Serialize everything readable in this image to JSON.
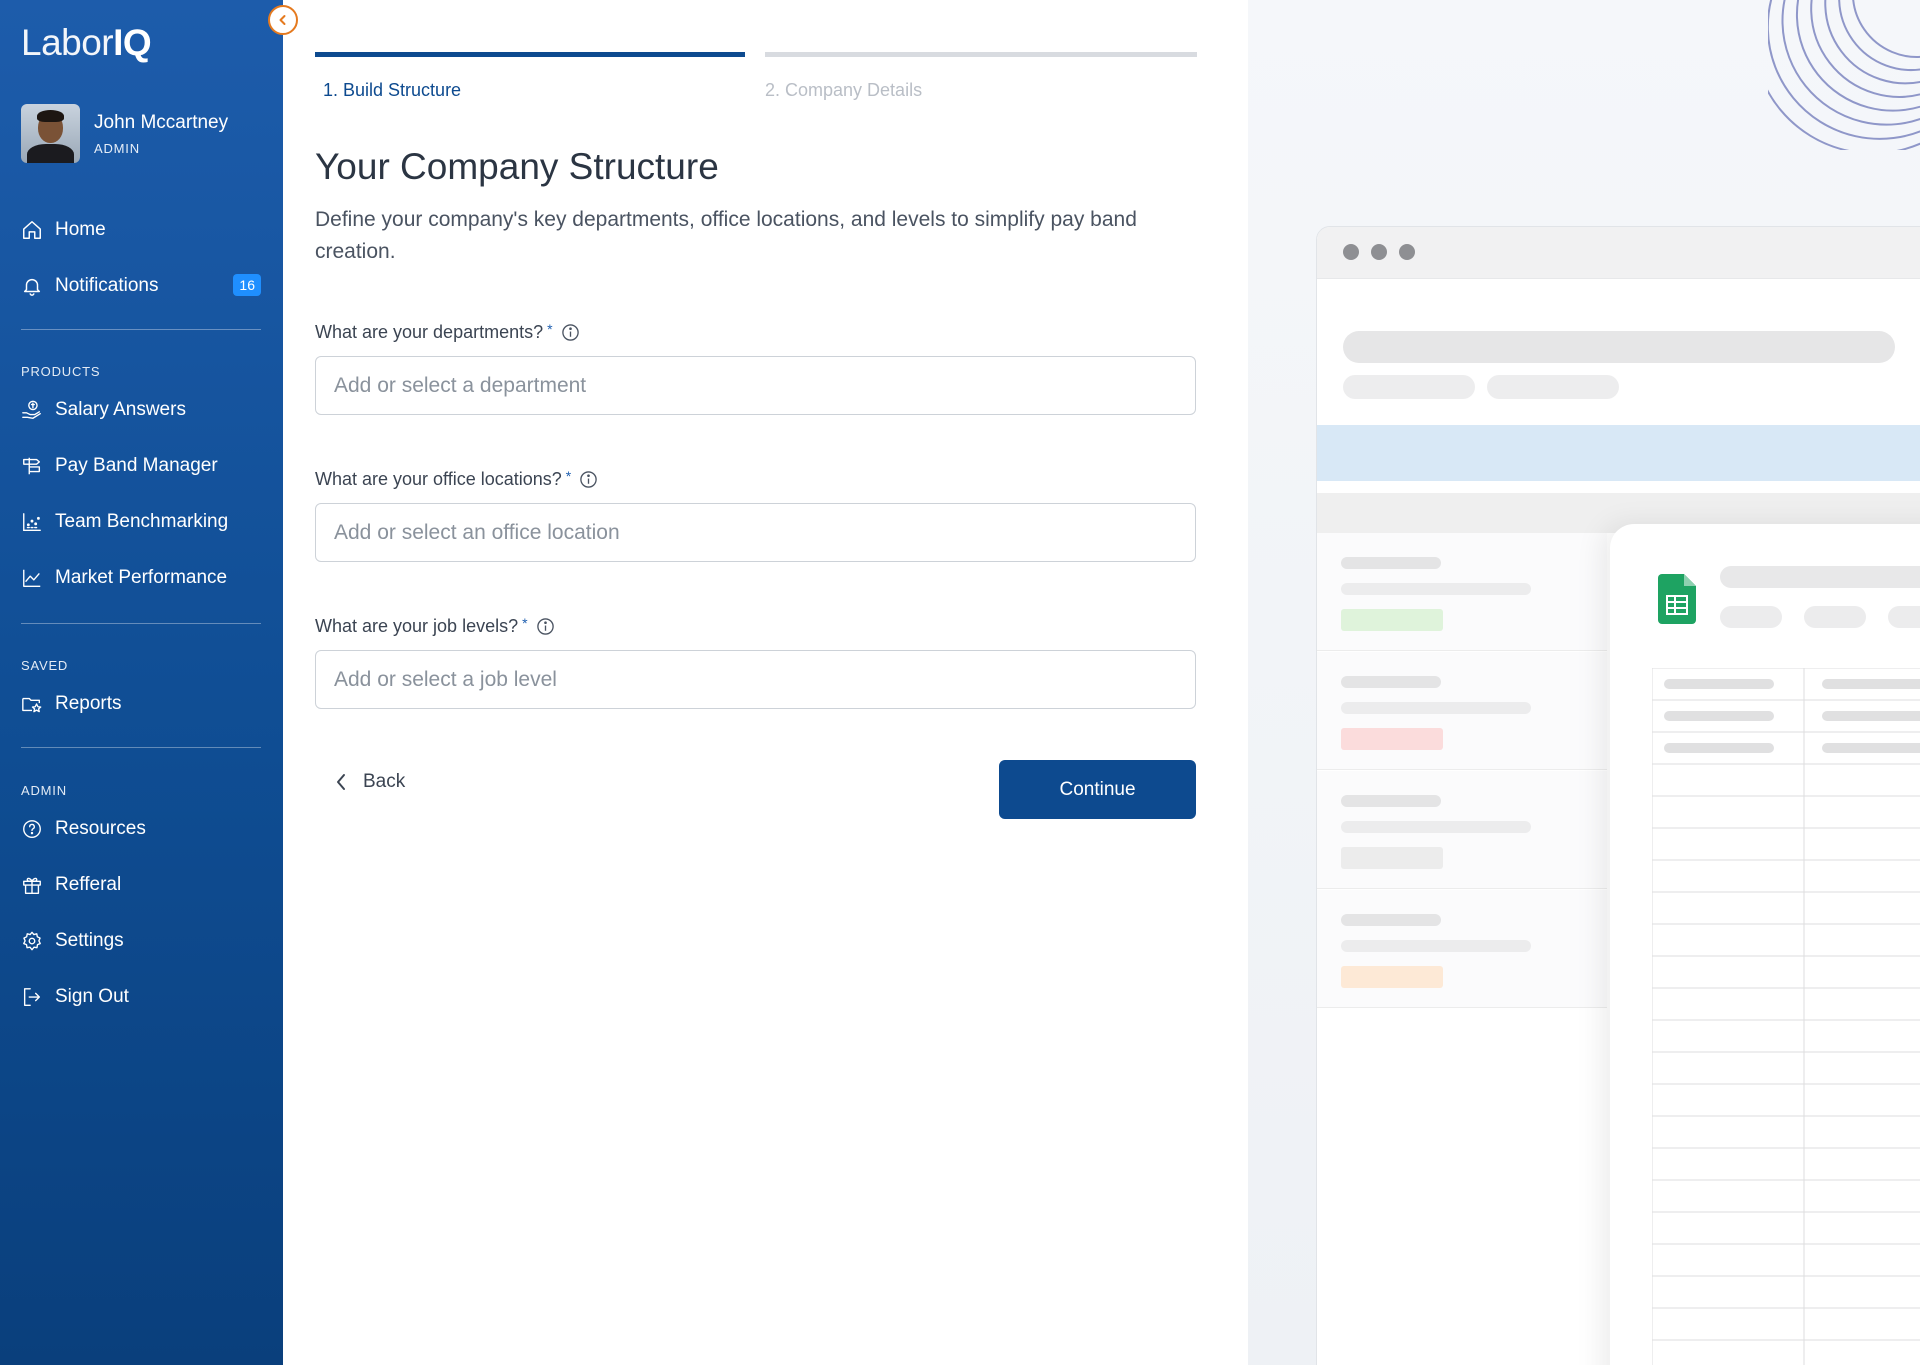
{
  "app": {
    "logo_part1": "Labor",
    "logo_part2": "IQ"
  },
  "user": {
    "name": "John Mccartney",
    "role": "ADMIN"
  },
  "sidebar": {
    "main_items": [
      {
        "label": "Home",
        "icon": "home-icon"
      },
      {
        "label": "Notifications",
        "icon": "bell-icon",
        "badge": "16"
      }
    ],
    "products_label": "PRODUCTS",
    "products": [
      {
        "label": "Salary Answers",
        "icon": "salary-hand-icon"
      },
      {
        "label": "Pay Band Manager",
        "icon": "signpost-icon"
      },
      {
        "label": "Team Benchmarking",
        "icon": "scatter-chart-icon"
      },
      {
        "label": "Market Performance",
        "icon": "line-chart-icon"
      }
    ],
    "saved_label": "SAVED",
    "saved": [
      {
        "label": "Reports",
        "icon": "folder-star-icon"
      }
    ],
    "admin_label": "ADMIN",
    "admin": [
      {
        "label": "Resources",
        "icon": "help-circle-icon"
      },
      {
        "label": "Refferal",
        "icon": "gift-icon"
      },
      {
        "label": "Settings",
        "icon": "gear-icon"
      },
      {
        "label": "Sign Out",
        "icon": "sign-out-icon"
      }
    ]
  },
  "steps": [
    {
      "label": "1. Build Structure",
      "active": true
    },
    {
      "label": "2. Company Details",
      "active": false
    }
  ],
  "page": {
    "title": "Your Company Structure",
    "description": "Define your company's key departments, office locations, and levels to simplify pay band creation."
  },
  "form": {
    "departments": {
      "label": "What are your departments?",
      "required": "*",
      "placeholder": "Add or select a department",
      "value": ""
    },
    "locations": {
      "label": "What are your office locations?",
      "required": "*",
      "placeholder": "Add or select an office location",
      "value": ""
    },
    "levels": {
      "label": "What are your job levels?",
      "required": "*",
      "placeholder": "Add or select a job level",
      "value": ""
    }
  },
  "actions": {
    "back_label": "Back",
    "continue_label": "Continue"
  },
  "colors": {
    "sidebar": "#0f4d93",
    "primary": "#0d4a8f",
    "badge": "#1f8fff",
    "collapse_accent": "#e57a1f"
  }
}
